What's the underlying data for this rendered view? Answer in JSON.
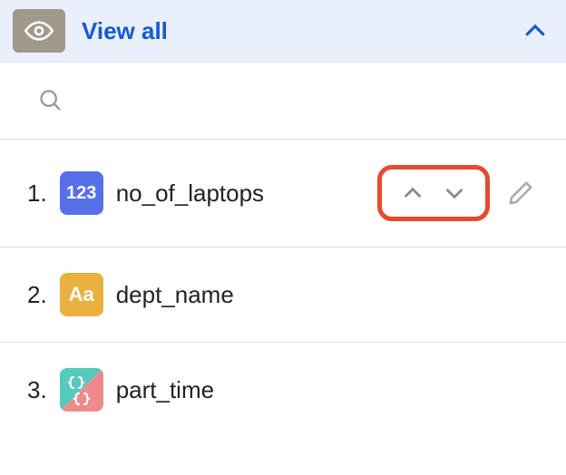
{
  "header": {
    "title": "View all"
  },
  "fields": [
    {
      "num": "1.",
      "badge_label": "123",
      "name": "no_of_laptops"
    },
    {
      "num": "2.",
      "badge_label": "Aa",
      "name": "dept_name"
    },
    {
      "num": "3.",
      "badge_label": "",
      "name": "part_time"
    }
  ]
}
